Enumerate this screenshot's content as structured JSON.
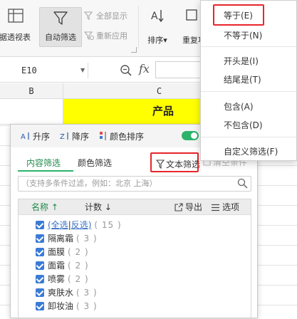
{
  "ribbon": {
    "pivot_label": "数据透视表",
    "autofilter_label": "自动筛选",
    "show_all_label": "全部显示",
    "reapply_label": "重新应用",
    "sort_label": "排序",
    "dup_label": "重复项"
  },
  "formula_bar": {
    "cell_ref": "E10",
    "fx": "fx"
  },
  "grid": {
    "columns": [
      "B",
      "C"
    ],
    "c1_value": "产品",
    "highlight_color": "#ffff00"
  },
  "filter_panel": {
    "toolbar": {
      "asc": "升序",
      "desc": "降序",
      "color_sort": "颜色排序"
    },
    "tabs": {
      "content": "内容筛选",
      "color": "颜色筛选",
      "text": "文本筛选",
      "clear": "清空条件"
    },
    "search_placeholder": "（支持多条件过滤，例如：北京  上海）",
    "list_header": {
      "name": "名称",
      "count": "计数",
      "export": "导出",
      "options": "选项"
    },
    "select_all": {
      "all": "(全选",
      "sep": "|",
      "invert": "反选)",
      "count": "( 15 )"
    },
    "items": [
      {
        "label": "隔离霜",
        "count": "( 3 )"
      },
      {
        "label": "面膜",
        "count": "( 2 )"
      },
      {
        "label": "面霜",
        "count": "( 2 )"
      },
      {
        "label": "喷雾",
        "count": "( 2 )"
      },
      {
        "label": "爽肤水",
        "count": "( 3 )"
      },
      {
        "label": "卸妆油",
        "count": "( 3 )"
      }
    ]
  },
  "text_filter_menu": {
    "items": [
      "等于(E)",
      "不等于(N)",
      "开头是(I)",
      "结尾是(T)",
      "包含(A)",
      "不包含(D)",
      "自定义筛选(F)"
    ]
  },
  "colors": {
    "accent_green": "#2db36b",
    "highlight_red": "#e8262b",
    "checkbox_blue": "#3a7bd5"
  }
}
